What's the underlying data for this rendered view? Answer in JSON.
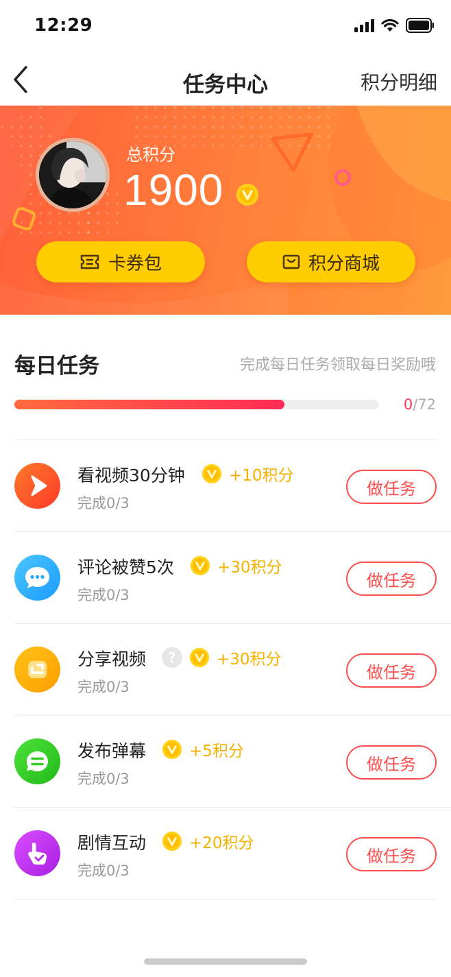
{
  "status_bar": {
    "time": "12:29",
    "icons": [
      "signal-icon",
      "wifi-icon",
      "battery-icon"
    ]
  },
  "nav": {
    "back_icon": "back-chevron-icon",
    "title": "任务中心",
    "right_label": "积分明细"
  },
  "banner": {
    "score_label": "总积分",
    "score_value": "1900",
    "coin_icon": "coin-v-icon",
    "buttons": [
      {
        "icon": "ticket-icon",
        "label": "卡券包"
      },
      {
        "icon": "mall-icon",
        "label": "积分商城"
      }
    ],
    "colors": {
      "gradient_start": "#ff5f3a",
      "gradient_end": "#ff9a3d",
      "button": "#ffcc00"
    }
  },
  "daily": {
    "title": "每日任务",
    "hint": "完成每日任务领取每日奖励哦",
    "progress": {
      "current": "0",
      "total": "/72",
      "fill_fraction": 0.74
    }
  },
  "tasks": [
    {
      "name": "看视频30分钟",
      "reward": "+10积分",
      "status": "完成0/3",
      "button": "做任务",
      "icon": "play-icon",
      "icon_color": "#ff5a2c",
      "has_help": false
    },
    {
      "name": "评论被赞5次",
      "reward": "+30积分",
      "status": "完成0/3",
      "button": "做任务",
      "icon": "comment-icon",
      "icon_color": "#22aaff",
      "has_help": false
    },
    {
      "name": "分享视频",
      "reward": "+30积分",
      "status": "完成0/3",
      "button": "做任务",
      "icon": "share-icon",
      "icon_color": "#ffb000",
      "has_help": true,
      "help": "?"
    },
    {
      "name": "发布弹幕",
      "reward": "+5积分",
      "status": "完成0/3",
      "button": "做任务",
      "icon": "danmaku-icon",
      "icon_color": "#33cc22",
      "has_help": false
    },
    {
      "name": "剧情互动",
      "reward": "+20积分",
      "status": "完成0/3",
      "button": "做任务",
      "icon": "tap-hand-icon",
      "icon_color": "#bb33ee",
      "has_help": false
    }
  ]
}
